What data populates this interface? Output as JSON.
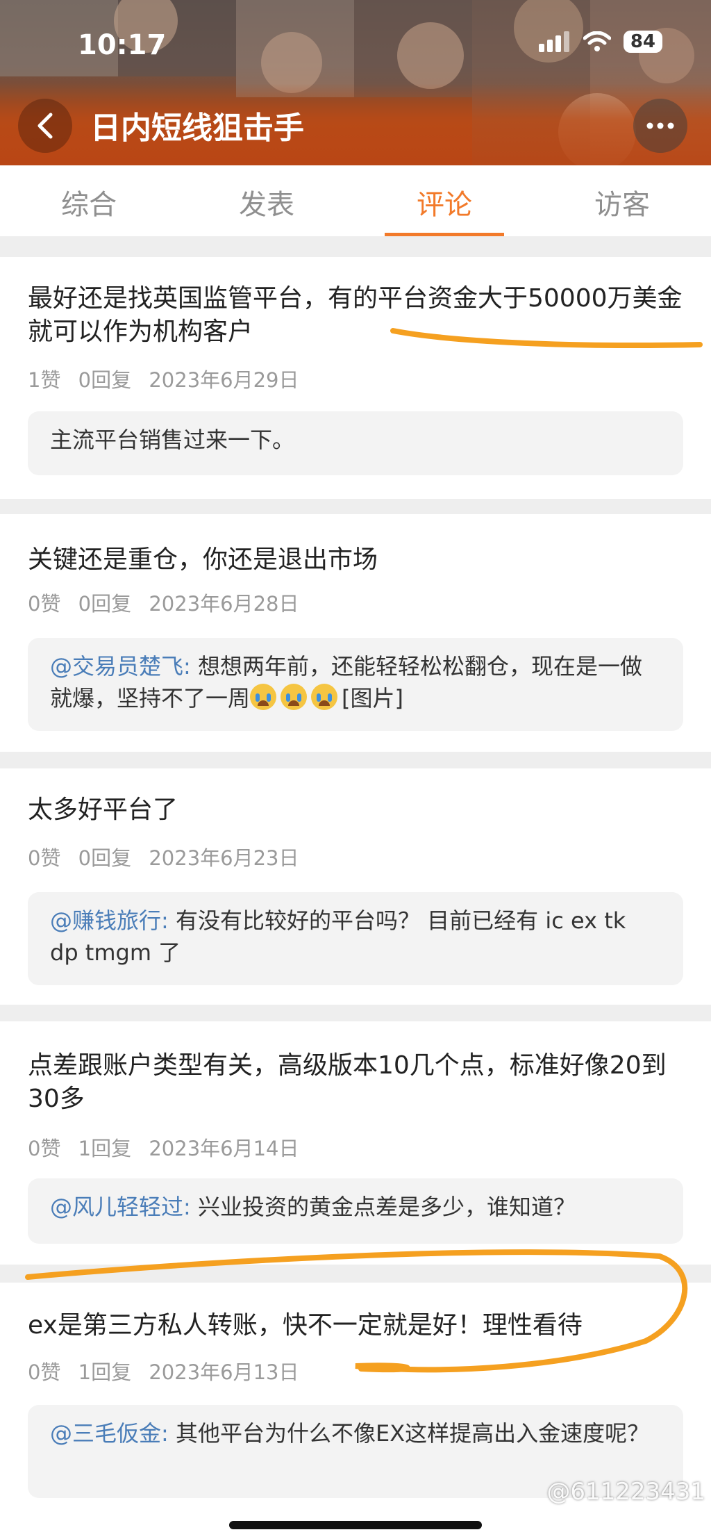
{
  "status_bar": {
    "time": "10:17",
    "battery": "84"
  },
  "header": {
    "title": "日内短线狙击手"
  },
  "tabs": [
    {
      "label": "综合",
      "active": false
    },
    {
      "label": "发表",
      "active": false
    },
    {
      "label": "评论",
      "active": true
    },
    {
      "label": "访客",
      "active": false
    }
  ],
  "comments": [
    {
      "text": "最好还是找英国监管平台，有的平台资金大于50000万美金就可以作为机构客户",
      "likes": "1赞",
      "replies": "0回复",
      "date": "2023年6月29日",
      "reply_mention": "",
      "reply_text": "主流平台销售过来一下。"
    },
    {
      "text": "关键还是重仓，你还是退出市场",
      "likes": "0赞",
      "replies": "0回复",
      "date": "2023年6月28日",
      "reply_mention": "@交易员楚飞:",
      "reply_text": " 想想两年前，还能轻轻松松翻仓，现在是一做就爆，坚持不了一周",
      "reply_suffix": "[图片]",
      "emoji": "loudly-crying-face"
    },
    {
      "text": "太多好平台了",
      "likes": "0赞",
      "replies": "0回复",
      "date": "2023年6月23日",
      "reply_mention": "@赚钱旅行:",
      "reply_text": " 有没有比较好的平台吗？ 目前已经有 ic ex tk dp tmgm 了"
    },
    {
      "text": "点差跟账户类型有关，高级版本10几个点，标准好像20到30多",
      "likes": "0赞",
      "replies": "1回复",
      "date": "2023年6月14日",
      "reply_mention": "@风儿轻轻过:",
      "reply_text": " 兴业投资的黄金点差是多少，谁知道？"
    },
    {
      "text": "ex是第三方私人转账，快不一定就是好！理性看待",
      "likes": "0赞",
      "replies": "1回复",
      "date": "2023年6月13日",
      "reply_mention": "@三毛仮金:",
      "reply_text": " 其他平台为什么不像EX这样提高出入金速度呢？"
    }
  ],
  "watermark": "@611223431",
  "colors": {
    "accent": "#f27a2a",
    "mention": "#4a7db8",
    "annotation": "#f5a020",
    "header": "#b6461c"
  }
}
